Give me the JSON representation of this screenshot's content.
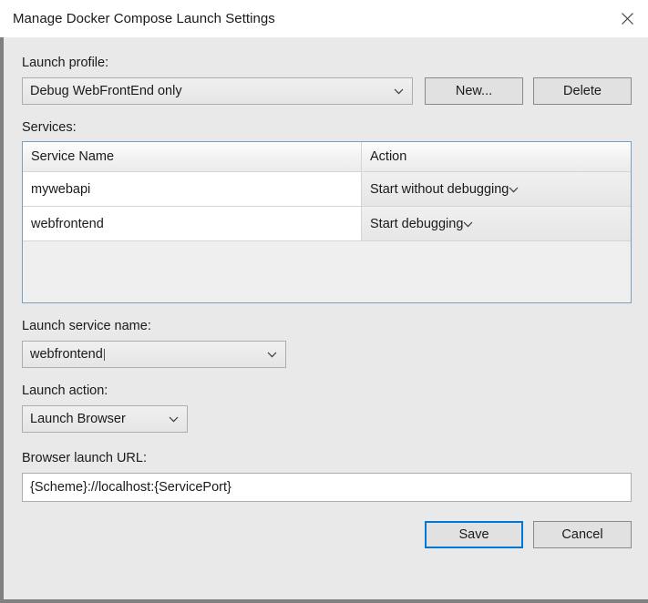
{
  "window": {
    "title": "Manage Docker Compose Launch Settings",
    "close_icon": "close-icon",
    "chevron_icon": "chevron-down-icon"
  },
  "launch_profile": {
    "label": "Launch profile:",
    "selected": "Debug WebFrontEnd only",
    "new_button": "New...",
    "delete_button": "Delete"
  },
  "services": {
    "label": "Services:",
    "columns": [
      "Service Name",
      "Action"
    ],
    "rows": [
      {
        "name": "mywebapi",
        "action": "Start without debugging"
      },
      {
        "name": "webfrontend",
        "action": "Start debugging"
      }
    ]
  },
  "launch_service_name": {
    "label": "Launch service name:",
    "selected": "webfrontend"
  },
  "launch_action": {
    "label": "Launch action:",
    "selected": "Launch Browser"
  },
  "browser_launch_url": {
    "label": "Browser launch URL:",
    "value": "{Scheme}://localhost:{ServicePort}"
  },
  "footer": {
    "save_button": "Save",
    "cancel_button": "Cancel"
  },
  "colors": {
    "accent": "#0078d7",
    "grid_border": "#7a9ec2",
    "dialog_background": "#e9e9e9",
    "window_frame": "#808080"
  }
}
